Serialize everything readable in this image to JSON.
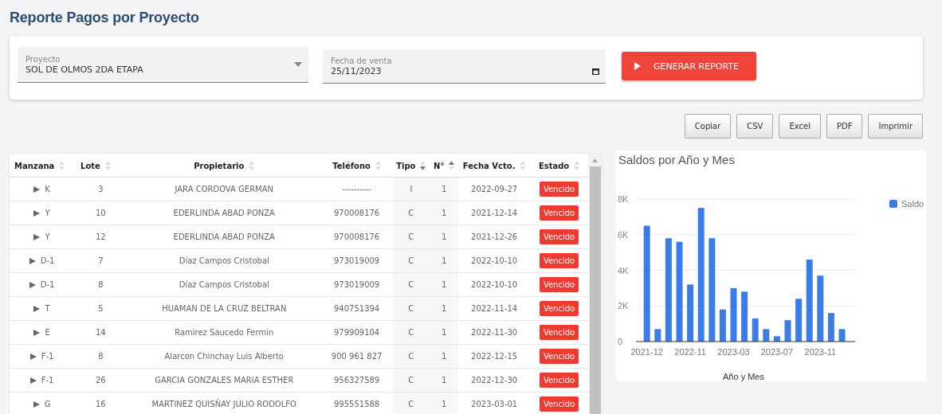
{
  "page_title": "Reporte Pagos por Proyecto",
  "filters": {
    "proyecto": {
      "label": "Proyecto",
      "value": "SOL DE OLMOS 2DA ETAPA"
    },
    "fecha": {
      "label": "Fecha de venta",
      "value": "25/11/2023"
    },
    "generate_button": "GENERAR REPORTE"
  },
  "export_buttons": [
    "Copiar",
    "CSV",
    "Excel",
    "PDF",
    "Imprimir"
  ],
  "table": {
    "columns": [
      {
        "label": "Manzana",
        "sort_asc": false,
        "sort_desc": false
      },
      {
        "label": "Lote",
        "sort_asc": false,
        "sort_desc": false
      },
      {
        "label": "Propietario",
        "sort_asc": false,
        "sort_desc": false
      },
      {
        "label": "Teléfono",
        "sort_asc": false,
        "sort_desc": false
      },
      {
        "label": "Tipo",
        "sort_asc": false,
        "sort_desc": true
      },
      {
        "label": "N°",
        "sort_asc": true,
        "sort_desc": false
      },
      {
        "label": "Fecha Vcto.",
        "sort_asc": false,
        "sort_desc": false
      },
      {
        "label": "Estado",
        "sort_asc": false,
        "sort_desc": false
      }
    ],
    "rows": [
      [
        "K",
        "3",
        "JARA CORDOVA GERMAN",
        "----------",
        "I",
        "1",
        "2022-09-27",
        "Vencido"
      ],
      [
        "Y",
        "10",
        "EDERLINDA ABAD PONZA",
        "970008176",
        "C",
        "1",
        "2021-12-14",
        "Vencido"
      ],
      [
        "Y",
        "12",
        "EDERLINDA ABAD PONZA",
        "970008176",
        "C",
        "1",
        "2021-12-26",
        "Vencido"
      ],
      [
        "D-1",
        "7",
        "Díaz Campos Cristobal",
        "973019009",
        "C",
        "1",
        "2022-10-10",
        "Vencido"
      ],
      [
        "D-1",
        "8",
        "Díaz Campos Cristobal",
        "973019009",
        "C",
        "1",
        "2022-10-10",
        "Vencido"
      ],
      [
        "T",
        "5",
        "HUAMAN DE LA CRUZ BELTRAN",
        "940751394",
        "C",
        "1",
        "2022-11-14",
        "Vencido"
      ],
      [
        "E",
        "14",
        "Ramirez Saucedo Fermin",
        "979909104",
        "C",
        "1",
        "2022-11-30",
        "Vencido"
      ],
      [
        "F-1",
        "8",
        "Alarcon Chinchay Luis Alberto",
        "900 961 827",
        "C",
        "1",
        "2022-12-15",
        "Vencido"
      ],
      [
        "F-1",
        "26",
        "GARCIA GONZALES MARIA ESTHER",
        "956327589",
        "C",
        "1",
        "2022-12-30",
        "Vencido"
      ],
      [
        "G",
        "16",
        "MARTINEZ QUISÑAY JULIO RODOLFO",
        "995551588",
        "C",
        "1",
        "2023-03-01",
        "Vencido"
      ]
    ]
  },
  "chart": {
    "chart_data": {
      "type": "bar",
      "title": "Saldos por Año y Mes",
      "xlabel": "Año y Mes",
      "categories": [
        "2021-12",
        null,
        null,
        null,
        "2022-11",
        null,
        null,
        null,
        "2023-03",
        null,
        null,
        null,
        "2023-07",
        null,
        null,
        null,
        "2023-11",
        null,
        null
      ],
      "ylim": [
        0,
        8000
      ],
      "grid": true,
      "yticks": [
        {
          "value": 0,
          "label": "0"
        },
        {
          "value": 2000,
          "label": "2K"
        },
        {
          "value": 4000,
          "label": "4K"
        },
        {
          "value": 6000,
          "label": "6K"
        },
        {
          "value": 8000,
          "label": "8K"
        }
      ],
      "series": [
        {
          "name": "Saldo",
          "color": "#3b7de8",
          "values": [
            6500,
            700,
            5800,
            5600,
            3200,
            7500,
            5800,
            1800,
            3000,
            2800,
            1300,
            700,
            300,
            1200,
            2400,
            4600,
            3700,
            1600,
            700
          ]
        }
      ]
    }
  }
}
